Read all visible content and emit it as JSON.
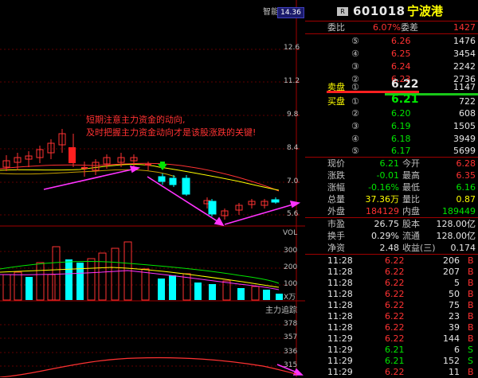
{
  "chart": {
    "indicator_label": "智能辅助",
    "price_label_box": "14.36",
    "price_axis": [
      "12.6",
      "11.2",
      "9.8",
      "8.4",
      "7.0",
      "5.6"
    ],
    "annotation_line1": "短期注意主力资金的动向,",
    "annotation_line2": "及时把握主力资金动向才是该股涨跌的关键!",
    "vol_label": "VOL",
    "vol_axis": [
      "300",
      "200",
      "100"
    ],
    "vol_unit": "X万",
    "main_track_label": "主力追踪",
    "track_axis": [
      "378",
      "357",
      "336",
      "315"
    ]
  },
  "stock": {
    "badge": "R",
    "code": "601018",
    "name": "宁波港"
  },
  "order_ratio": {
    "label1": "委比",
    "value1": "6.07%",
    "label2": "委差",
    "value2": "1427"
  },
  "sell_orders": [
    {
      "level": "⑤",
      "price": "6.26",
      "volume": "1476"
    },
    {
      "level": "④",
      "price": "6.25",
      "volume": "3454"
    },
    {
      "level": "③",
      "price": "6.24",
      "volume": "2242"
    },
    {
      "level": "②",
      "price": "6.23",
      "volume": "2736"
    }
  ],
  "sell1": {
    "label": "卖盘",
    "level": "①",
    "price": "6.22",
    "volume": "1147"
  },
  "buy1": {
    "label": "买盘",
    "level": "①",
    "price": "6.21",
    "volume": "722"
  },
  "buy_orders": [
    {
      "level": "②",
      "price": "6.20",
      "volume": "608"
    },
    {
      "level": "③",
      "price": "6.19",
      "volume": "1505"
    },
    {
      "level": "④",
      "price": "6.18",
      "volume": "3949"
    },
    {
      "level": "⑤",
      "price": "6.17",
      "volume": "5699"
    }
  ],
  "quote": [
    {
      "l1": "现价",
      "v1": "6.21",
      "c1": "green",
      "l2": "今开",
      "v2": "6.28",
      "c2": "red"
    },
    {
      "l1": "涨跌",
      "v1": "-0.01",
      "c1": "green",
      "l2": "最高",
      "v2": "6.35",
      "c2": "red"
    },
    {
      "l1": "涨幅",
      "v1": "-0.16%",
      "c1": "green",
      "l2": "最低",
      "v2": "6.16",
      "c2": "green"
    },
    {
      "l1": "总量",
      "v1": "37.36万",
      "c1": "yellow",
      "l2": "量比",
      "v2": "0.87",
      "c2": "yellow"
    },
    {
      "l1": "外盘",
      "v1": "184129",
      "c1": "red",
      "l2": "内盘",
      "v2": "189449",
      "c2": "green"
    }
  ],
  "fundamentals": [
    {
      "l1": "市盈",
      "v1": "26.75",
      "l2": "股本",
      "v2": "128.00亿"
    },
    {
      "l1": "换手",
      "v1": "0.29%",
      "l2": "流通",
      "v2": "128.00亿"
    },
    {
      "l1": "净资",
      "v1": "2.48",
      "l2": "收益(三)",
      "v2": "0.174"
    }
  ],
  "ticks": [
    {
      "time": "11:28",
      "price": "6.22",
      "pc": "red",
      "vol": "206",
      "side": "B",
      "sc": "red"
    },
    {
      "time": "11:28",
      "price": "6.22",
      "pc": "red",
      "vol": "207",
      "side": "B",
      "sc": "red"
    },
    {
      "time": "11:28",
      "price": "6.22",
      "pc": "red",
      "vol": "5",
      "side": "B",
      "sc": "red"
    },
    {
      "time": "11:28",
      "price": "6.22",
      "pc": "red",
      "vol": "50",
      "side": "B",
      "sc": "red"
    },
    {
      "time": "11:28",
      "price": "6.22",
      "pc": "red",
      "vol": "75",
      "side": "B",
      "sc": "red"
    },
    {
      "time": "11:28",
      "price": "6.22",
      "pc": "red",
      "vol": "23",
      "side": "B",
      "sc": "red"
    },
    {
      "time": "11:28",
      "price": "6.22",
      "pc": "red",
      "vol": "39",
      "side": "B",
      "sc": "red"
    },
    {
      "time": "11:29",
      "price": "6.22",
      "pc": "red",
      "vol": "144",
      "side": "B",
      "sc": "red"
    },
    {
      "time": "11:29",
      "price": "6.21",
      "pc": "green",
      "vol": "6",
      "side": "S",
      "sc": "green"
    },
    {
      "time": "11:29",
      "price": "6.21",
      "pc": "green",
      "vol": "152",
      "side": "S",
      "sc": "green"
    },
    {
      "time": "11:29",
      "price": "6.22",
      "pc": "red",
      "vol": "11",
      "side": "B",
      "sc": "red"
    }
  ],
  "colors": {
    "up": "#ff3232",
    "down": "#00ffff",
    "ma5": "#ffff00",
    "ma10": "#ff3232",
    "arrow": "#ff33ff",
    "vol_ma": "#00e600"
  }
}
